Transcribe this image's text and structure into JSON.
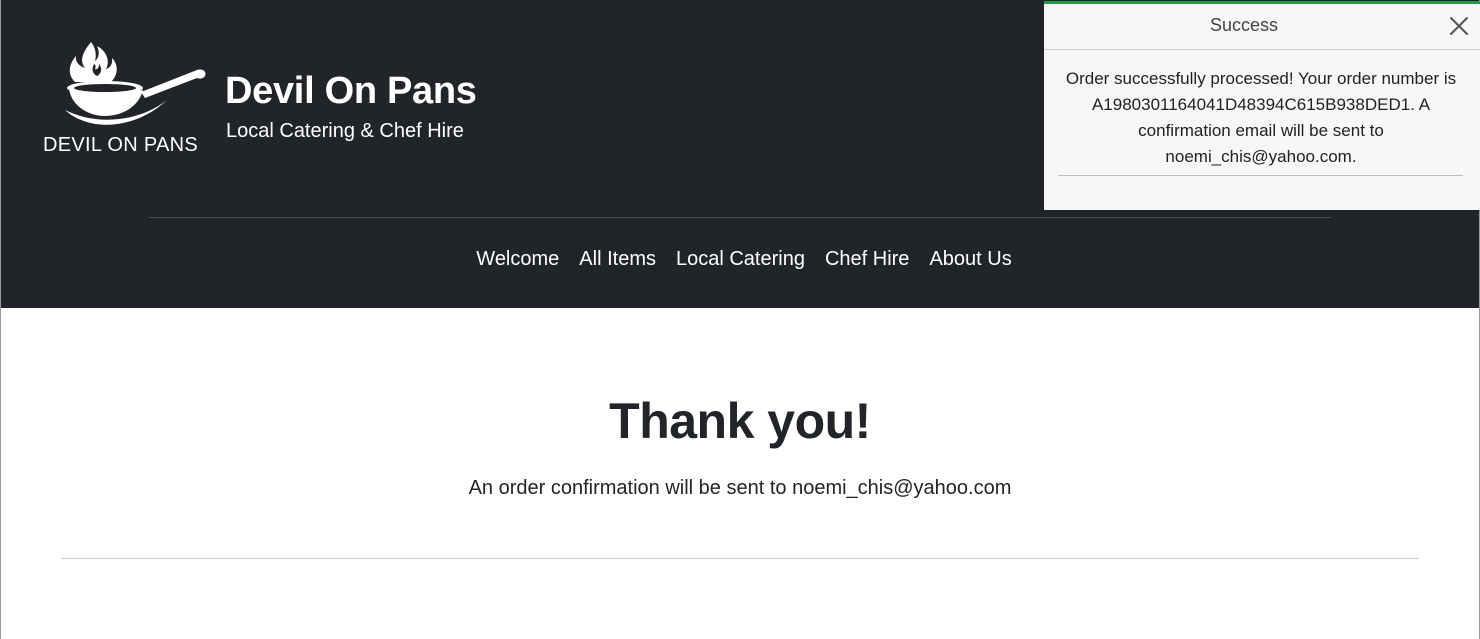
{
  "brand": {
    "logo_text": "DEVIL ON PANS",
    "title": "Devil On Pans",
    "subtitle": "Local Catering & Chef Hire"
  },
  "nav": {
    "items": [
      {
        "label": "Welcome"
      },
      {
        "label": "All Items"
      },
      {
        "label": "Local Catering"
      },
      {
        "label": "Chef Hire"
      },
      {
        "label": "About Us"
      }
    ]
  },
  "main": {
    "heading": "Thank you!",
    "message": "An order confirmation will be sent to noemi_chis@yahoo.com"
  },
  "toast": {
    "title": "Success",
    "message": "Order successfully processed! Your order number is A1980301164041D48394C615B938DED1. A confirmation email will be sent to noemi_chis@yahoo.com.",
    "accent_color": "#1f9b4a"
  },
  "colors": {
    "header_bg": "#212529",
    "text_dark": "#212529"
  }
}
